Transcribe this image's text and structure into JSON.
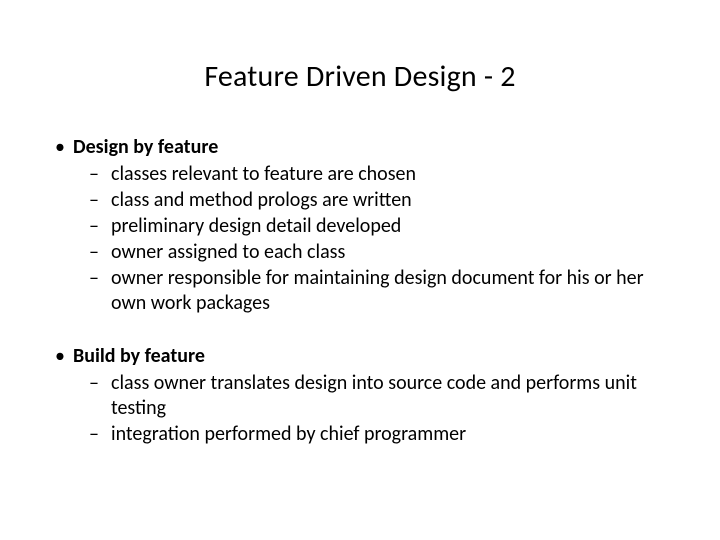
{
  "title": "Feature Driven Design - 2",
  "sections": [
    {
      "heading": "Design by feature",
      "items": [
        "classes relevant to feature are chosen",
        "class and method prologs are written",
        "preliminary design detail developed",
        "owner assigned to each class",
        "owner responsible for maintaining design document for his or her own work packages"
      ]
    },
    {
      "heading": "Build by feature",
      "items": [
        "class owner translates design into source code and performs unit testing",
        "integration performed by chief programmer"
      ]
    }
  ]
}
